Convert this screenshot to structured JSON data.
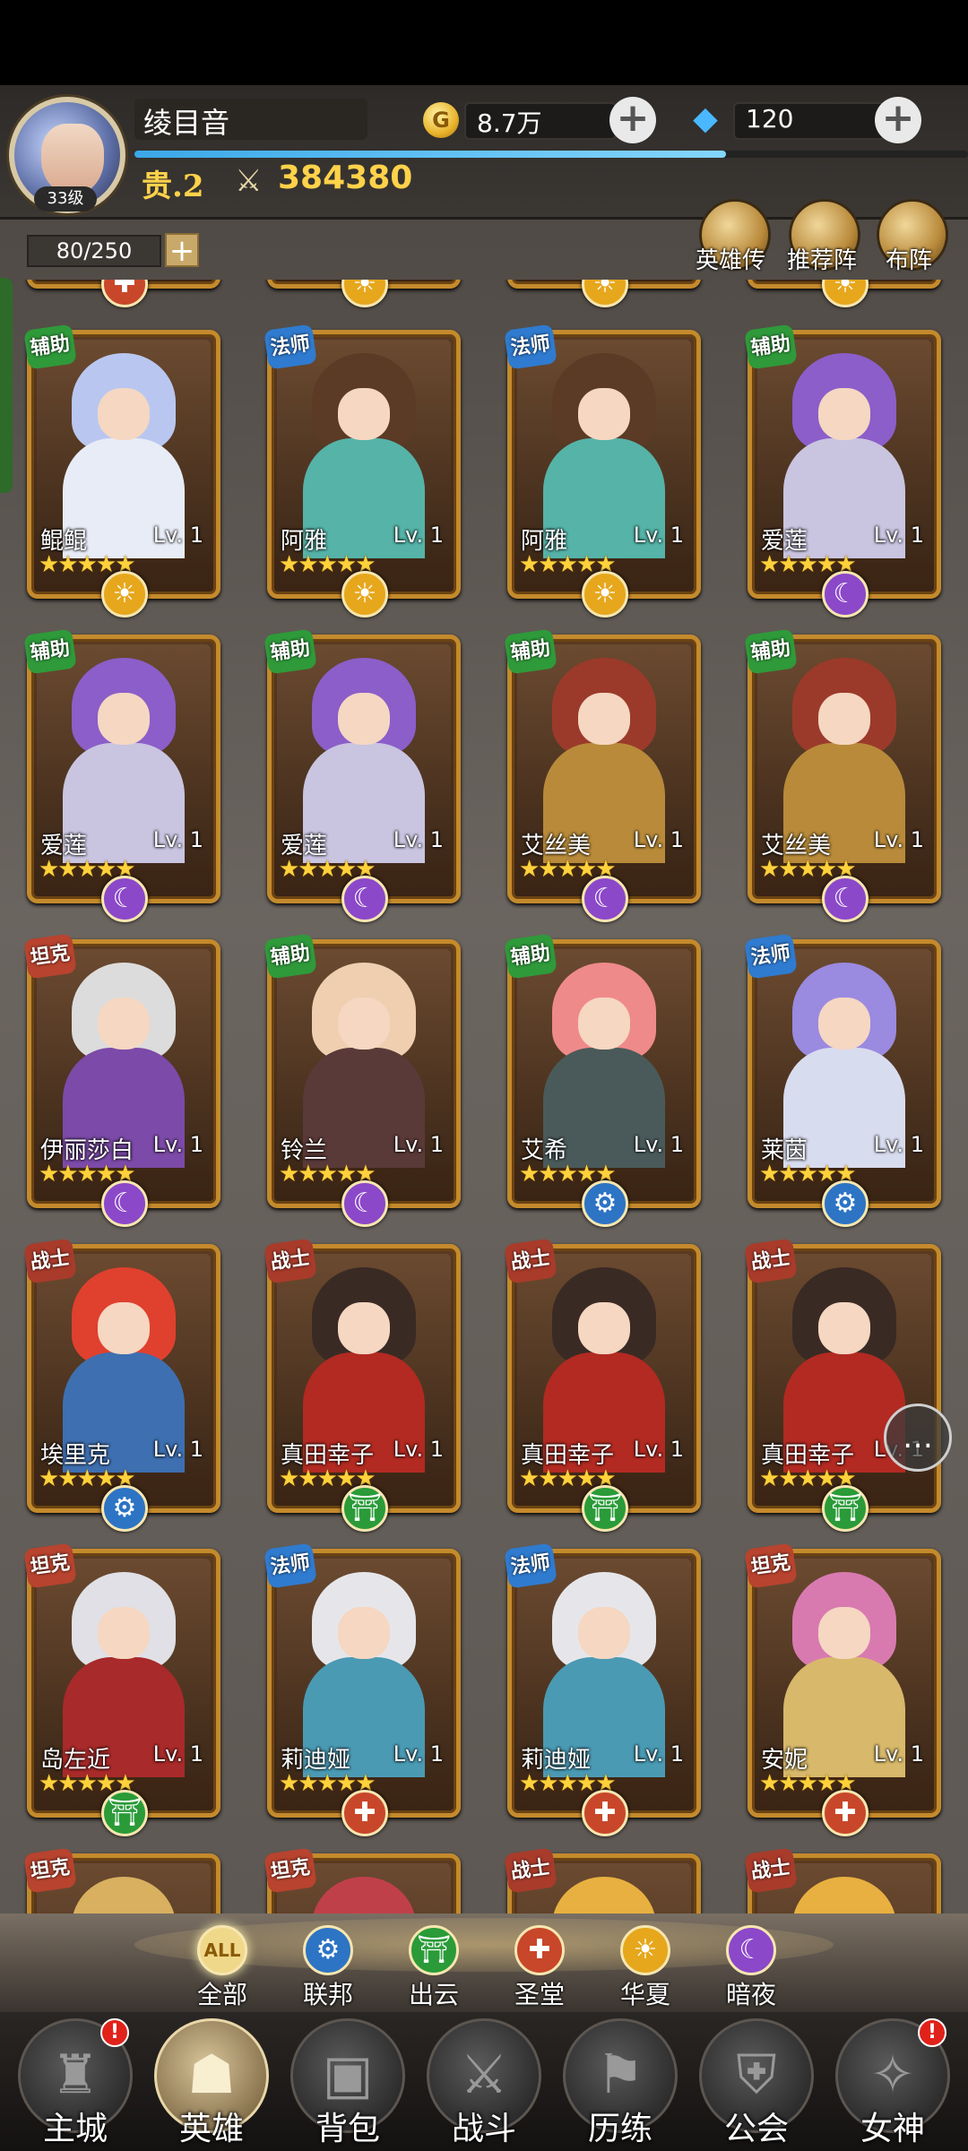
{
  "player": {
    "name": "绫目音",
    "level": "33级",
    "vip": "贵.2",
    "power": "384380",
    "exp_fraction": 0.71
  },
  "resources": {
    "gold": "8.7万",
    "gems": "120"
  },
  "capacity": "80/250",
  "top_buttons": {
    "hero_story": "英雄传",
    "recommend": "推荐阵",
    "formation": "布阵"
  },
  "colors": {
    "support_badge": "#2f9a3a",
    "mage_badge": "#2f7bd0",
    "tank_badge": "#b8432e",
    "warrior_badge": "#a93b2b",
    "huaxia": "#e6a71c",
    "anye": "#8b48c9",
    "lianbang": "#2d74c4",
    "chuyun": "#2a9b38",
    "shengtang": "#c8472a"
  },
  "partial_top_row": [
    {
      "faction": "shengtang",
      "icon": "cross-icon"
    },
    {
      "faction": "huaxia",
      "icon": "sun-icon"
    },
    {
      "faction": "huaxia",
      "icon": "sun-icon"
    },
    {
      "faction": "huaxia",
      "icon": "sun-icon"
    }
  ],
  "heroes": [
    {
      "class": "辅助",
      "class_key": "support",
      "name": "鲲鲲",
      "lv": "Lv. 1",
      "stars": "★★★★★",
      "faction": "huaxia",
      "icon": "sun-icon",
      "hair": "#b9c7f0",
      "body": "#e8ecf6"
    },
    {
      "class": "法师",
      "class_key": "mage",
      "name": "阿雅",
      "lv": "Lv. 1",
      "stars": "★★★★★",
      "faction": "huaxia",
      "icon": "sun-icon",
      "hair": "#5b3a26",
      "body": "#55b3a8"
    },
    {
      "class": "法师",
      "class_key": "mage",
      "name": "阿雅",
      "lv": "Lv. 1",
      "stars": "★★★★★",
      "faction": "huaxia",
      "icon": "sun-icon",
      "hair": "#5b3a26",
      "body": "#55b3a8"
    },
    {
      "class": "辅助",
      "class_key": "support",
      "name": "爱莲",
      "lv": "Lv. 1",
      "stars": "★★★★★",
      "faction": "anye",
      "icon": "moon-icon",
      "hair": "#8b5ec9",
      "body": "#c9c4e0"
    },
    {
      "class": "辅助",
      "class_key": "support",
      "name": "爱莲",
      "lv": "Lv. 1",
      "stars": "★★★★★",
      "faction": "anye",
      "icon": "moon-icon",
      "hair": "#8b5ec9",
      "body": "#c9c4e0"
    },
    {
      "class": "辅助",
      "class_key": "support",
      "name": "爱莲",
      "lv": "Lv. 1",
      "stars": "★★★★★",
      "faction": "anye",
      "icon": "moon-icon",
      "hair": "#8b5ec9",
      "body": "#c9c4e0"
    },
    {
      "class": "辅助",
      "class_key": "support",
      "name": "艾丝美",
      "lv": "Lv. 1",
      "stars": "★★★★★",
      "faction": "anye",
      "icon": "moon-icon",
      "hair": "#9b3a2a",
      "body": "#b88a3a"
    },
    {
      "class": "辅助",
      "class_key": "support",
      "name": "艾丝美",
      "lv": "Lv. 1",
      "stars": "★★★★★",
      "faction": "anye",
      "icon": "moon-icon",
      "hair": "#9b3a2a",
      "body": "#b88a3a"
    },
    {
      "class": "坦克",
      "class_key": "tank",
      "name": "伊丽莎白",
      "lv": "Lv. 1",
      "stars": "★★★★★",
      "faction": "anye",
      "icon": "moon-icon",
      "hair": "#dcdcdc",
      "body": "#7c4aa8"
    },
    {
      "class": "辅助",
      "class_key": "support",
      "name": "铃兰",
      "lv": "Lv. 1",
      "stars": "★★★★★",
      "faction": "anye",
      "icon": "moon-icon",
      "hair": "#efcfb0",
      "body": "#5a3a38"
    },
    {
      "class": "辅助",
      "class_key": "support",
      "name": "艾希",
      "lv": "Lv. 1",
      "stars": "★★★★★",
      "faction": "lianbang",
      "icon": "gear-icon",
      "hair": "#ef8a8a",
      "body": "#4a5a5a"
    },
    {
      "class": "法师",
      "class_key": "mage",
      "name": "莱茵",
      "lv": "Lv. 1",
      "stars": "★★★★★",
      "faction": "lianbang",
      "icon": "gear-icon",
      "hair": "#9a8ae0",
      "body": "#d8dcef"
    },
    {
      "class": "战士",
      "class_key": "warrior",
      "name": "埃里克",
      "lv": "Lv. 1",
      "stars": "★★★★★",
      "faction": "lianbang",
      "icon": "gear-icon",
      "hair": "#e0402e",
      "body": "#3e6fb0"
    },
    {
      "class": "战士",
      "class_key": "warrior",
      "name": "真田幸子",
      "lv": "Lv. 1",
      "stars": "★★★★★",
      "faction": "chuyun",
      "icon": "torii-icon",
      "hair": "#3a2a24",
      "body": "#b22a22"
    },
    {
      "class": "战士",
      "class_key": "warrior",
      "name": "真田幸子",
      "lv": "Lv. 1",
      "stars": "★★★★★",
      "faction": "chuyun",
      "icon": "torii-icon",
      "hair": "#3a2a24",
      "body": "#b22a22"
    },
    {
      "class": "战士",
      "class_key": "warrior",
      "name": "真田幸子",
      "lv": "Lv. 1",
      "stars": "★★★★★",
      "faction": "chuyun",
      "icon": "torii-icon",
      "hair": "#3a2a24",
      "body": "#b22a22"
    },
    {
      "class": "坦克",
      "class_key": "tank",
      "name": "岛左近",
      "lv": "Lv. 1",
      "stars": "★★★★★",
      "faction": "chuyun",
      "icon": "torii-icon",
      "hair": "#e0e0e6",
      "body": "#a82a2a"
    },
    {
      "class": "法师",
      "class_key": "mage",
      "name": "莉迪娅",
      "lv": "Lv. 1",
      "stars": "★★★★★",
      "faction": "shengtang",
      "icon": "cross-icon",
      "hair": "#e6e6ea",
      "body": "#4a9ab4"
    },
    {
      "class": "法师",
      "class_key": "mage",
      "name": "莉迪娅",
      "lv": "Lv. 1",
      "stars": "★★★★★",
      "faction": "shengtang",
      "icon": "cross-icon",
      "hair": "#e6e6ea",
      "body": "#4a9ab4"
    },
    {
      "class": "坦克",
      "class_key": "tank",
      "name": "安妮",
      "lv": "Lv. 1",
      "stars": "★★★★★",
      "faction": "shengtang",
      "icon": "cross-icon",
      "hair": "#d87ab0",
      "body": "#d8b86a"
    }
  ],
  "partial_bottom_row": [
    {
      "class": "坦克",
      "class_key": "tank",
      "hair": "#d8b060"
    },
    {
      "class": "坦克",
      "class_key": "tank",
      "hair": "#c0404a"
    },
    {
      "class": "战士",
      "class_key": "warrior",
      "hair": "#e8b040"
    },
    {
      "class": "战士",
      "class_key": "warrior",
      "hair": "#e8b040"
    }
  ],
  "filters": [
    {
      "label": "全部",
      "key": "all",
      "icon_text": "ALL",
      "icon": "all-icon"
    },
    {
      "label": "联邦",
      "key": "lianbang",
      "icon_text": "⚙",
      "icon": "gear-icon"
    },
    {
      "label": "出云",
      "key": "chuyun",
      "icon_text": "⛩",
      "icon": "torii-icon"
    },
    {
      "label": "圣堂",
      "key": "shengtang",
      "icon_text": "✚",
      "icon": "cross-icon"
    },
    {
      "label": "华夏",
      "key": "huaxia",
      "icon_text": "☀",
      "icon": "sun-icon"
    },
    {
      "label": "暗夜",
      "key": "anye",
      "icon_text": "☾",
      "icon": "moon-icon"
    }
  ],
  "nav": [
    {
      "label": "主城",
      "icon": "castle-icon",
      "glyph": "♜",
      "badge": "!",
      "active": false
    },
    {
      "label": "英雄",
      "icon": "hero-icon",
      "glyph": "☗",
      "badge": "",
      "active": true
    },
    {
      "label": "背包",
      "icon": "backpack-icon",
      "glyph": "▣",
      "badge": "",
      "active": false
    },
    {
      "label": "战斗",
      "icon": "swords-icon",
      "glyph": "⚔",
      "badge": "",
      "active": false
    },
    {
      "label": "历练",
      "icon": "map-icon",
      "glyph": "⚑",
      "badge": "",
      "active": false
    },
    {
      "label": "公会",
      "icon": "shield-icon",
      "glyph": "⛨",
      "badge": "",
      "active": false
    },
    {
      "label": "女神",
      "icon": "goddess-icon",
      "glyph": "✧",
      "badge": "!",
      "active": false
    }
  ],
  "chat_icon": "chat-icon"
}
